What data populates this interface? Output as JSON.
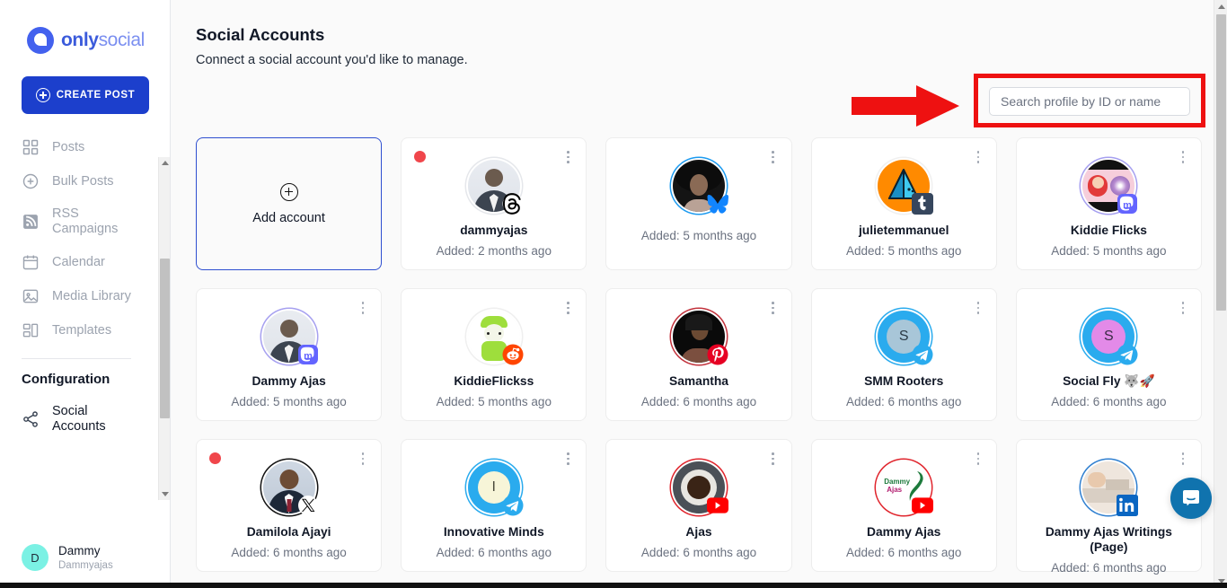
{
  "brand": {
    "part1": "only",
    "part2": "social"
  },
  "sidebar": {
    "create_post_label": "CREATE POST",
    "items": [
      {
        "label": "Posts",
        "icon": "grid-icon"
      },
      {
        "label": "Bulk Posts",
        "icon": "plus-circle-icon"
      },
      {
        "label": "RSS Campaigns",
        "icon": "rss-icon"
      },
      {
        "label": "Calendar",
        "icon": "calendar-icon"
      },
      {
        "label": "Media Library",
        "icon": "image-icon"
      },
      {
        "label": "Templates",
        "icon": "templates-icon"
      }
    ],
    "config_title": "Configuration",
    "config_items": [
      {
        "label": "Social Accounts",
        "icon": "share-icon",
        "active": true
      }
    ],
    "profile": {
      "initial": "D",
      "name": "Dammy",
      "handle": "Dammyajas"
    }
  },
  "header": {
    "title": "Social Accounts",
    "subtitle": "Connect a social account you'd like to manage."
  },
  "search": {
    "placeholder": "Search profile by ID or name",
    "value": "",
    "highlight_color": "#ee1111",
    "arrow_color": "#ee1111"
  },
  "add_card": {
    "label": "Add account",
    "icon": "plus-circle-icon"
  },
  "accounts": [
    {
      "name": "dammyajas",
      "added": "Added: 2 months ago",
      "network": "threads",
      "ring": "#e5e7eb",
      "alert": true,
      "av_bg": "#e8eaef",
      "av_text": "",
      "photo": "man-suit"
    },
    {
      "name": "",
      "added": "Added: 5 months ago",
      "network": "bluesky",
      "ring": "#1d9bf0",
      "alert": false,
      "av_bg": "#1a1a1a",
      "av_text": "",
      "photo": "woman-curly"
    },
    {
      "name": "julietemmanuel",
      "added": "Added: 5 months ago",
      "network": "tumblr",
      "ring": "#f0f0f0",
      "alert": false,
      "av_bg": "#ff8a00",
      "av_text": "",
      "photo": "prism"
    },
    {
      "name": "Kiddie Flicks",
      "added": "Added: 5 months ago",
      "network": "mastodon",
      "ring": "#a6a0f0",
      "alert": false,
      "av_bg": "#f3c9d4",
      "av_text": "",
      "photo": "cartoon-girl"
    },
    {
      "name": "Dammy Ajas",
      "added": "Added: 5 months ago",
      "network": "mastodon",
      "ring": "#a6a0f0",
      "alert": false,
      "av_bg": "#e8eaef",
      "av_text": "",
      "photo": "man-suit"
    },
    {
      "name": "KiddieFlickss",
      "added": "Added: 5 months ago",
      "network": "reddit",
      "ring": "#efefef",
      "alert": false,
      "av_bg": "#ffffff",
      "av_text": "",
      "photo": "green-character"
    },
    {
      "name": "Samantha",
      "added": "Added: 6 months ago",
      "network": "pinterest",
      "ring": "#c2323c",
      "alert": false,
      "av_bg": "#1a1a1a",
      "av_text": "",
      "photo": "woman-dark"
    },
    {
      "name": "SMM Rooters",
      "added": "Added: 6 months ago",
      "network": "telegram",
      "ring": "#2aabee",
      "alert": false,
      "av_bg": "#2aabee",
      "av_text": "S",
      "photo": "letter"
    },
    {
      "name": "Social Fly 🐺🚀",
      "added": "Added: 6 months ago",
      "network": "telegram",
      "ring": "#2aabee",
      "alert": false,
      "av_bg": "#2aabee",
      "av_text": "S",
      "photo": "letter-pink"
    },
    {
      "name": "Damilola Ajayi",
      "added": "Added: 6 months ago",
      "network": "x",
      "ring": "#111111",
      "alert": true,
      "av_bg": "#dfe4ea",
      "av_text": "",
      "photo": "man-suit-color"
    },
    {
      "name": "Innovative Minds",
      "added": "Added: 6 months ago",
      "network": "telegram",
      "ring": "#2aabee",
      "alert": false,
      "av_bg": "#2aabee",
      "av_text": "I",
      "photo": "letter-cream"
    },
    {
      "name": "Ajas",
      "added": "Added: 6 months ago",
      "network": "youtube",
      "ring": "#e0242c",
      "alert": false,
      "av_bg": "#4a4f55",
      "av_text": "",
      "photo": "coffee"
    },
    {
      "name": "Dammy Ajas",
      "added": "Added: 6 months ago",
      "network": "youtube",
      "ring": "#e0242c",
      "alert": false,
      "av_bg": "#ffffff",
      "av_text": "",
      "photo": "dammy-logo"
    },
    {
      "name": "Dammy Ajas Writings (Page)",
      "added": "Added: 6 months ago",
      "network": "linkedin",
      "ring": "#2f7fd0",
      "alert": false,
      "av_bg": "#e9e0d8",
      "av_text": "",
      "photo": "desk"
    }
  ],
  "intercom": {
    "icon": "chat-bubble-icon"
  }
}
